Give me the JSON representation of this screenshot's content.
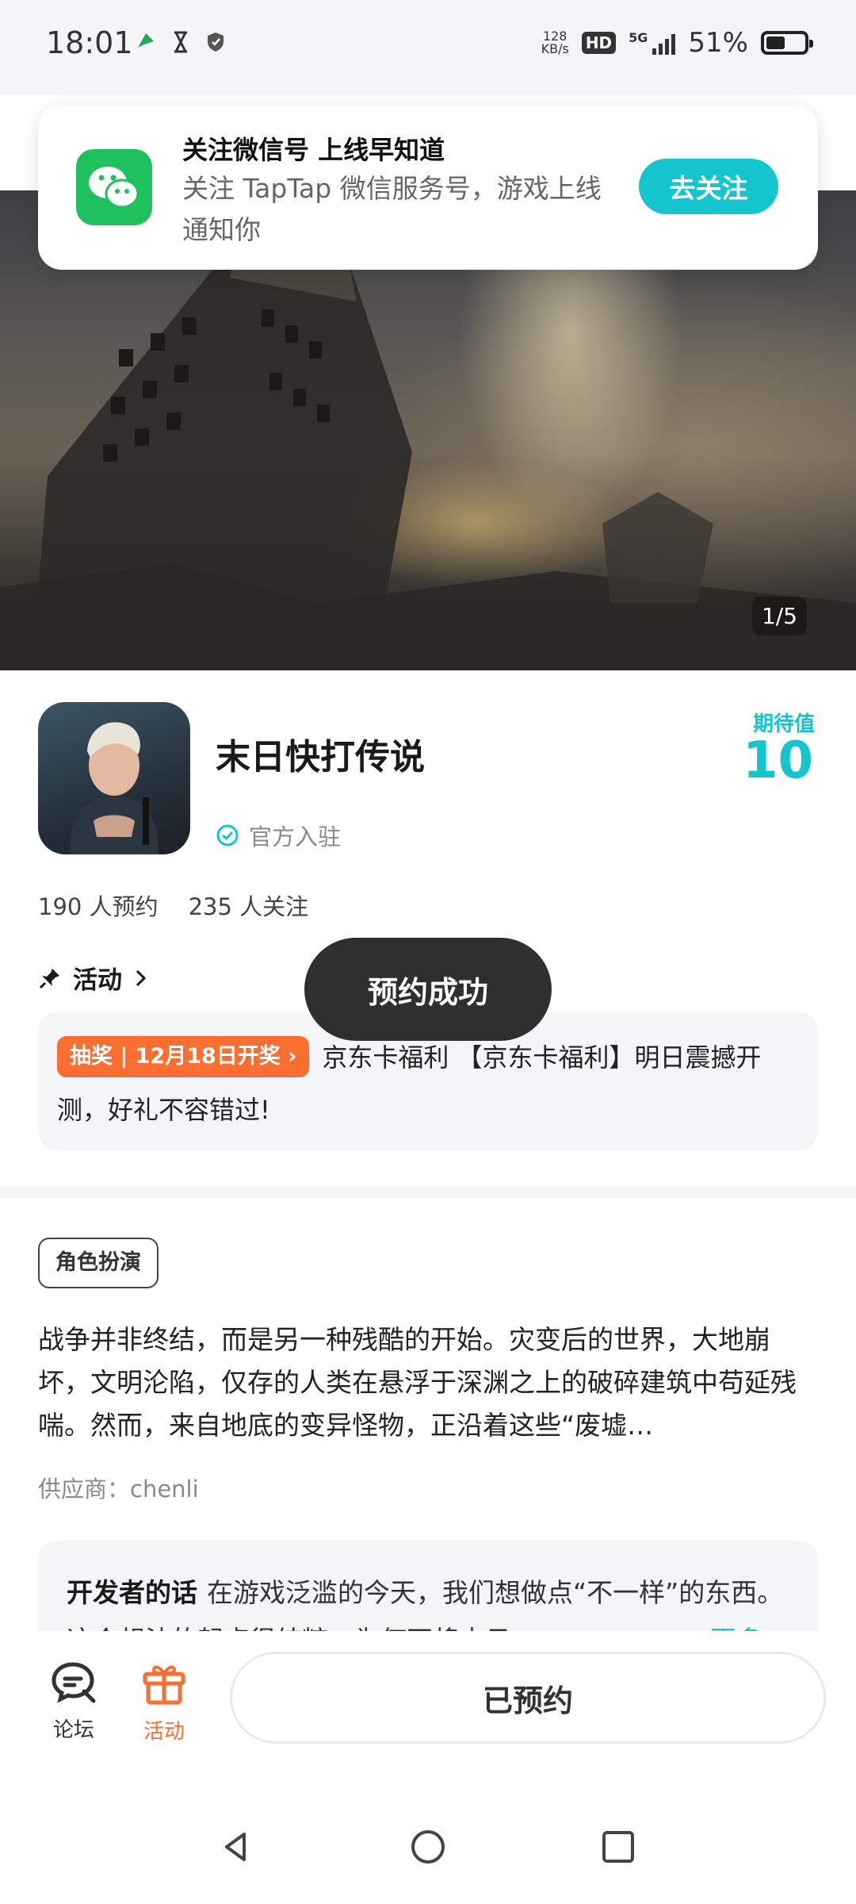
{
  "status_bar": {
    "time": "18:01",
    "net_speed_value": "128",
    "net_speed_unit": "KB/s",
    "hd": "HD",
    "network": "5G",
    "battery_percent_text": "51%",
    "battery_level": 0.51
  },
  "follow_banner": {
    "title": "关注微信号 上线早知道",
    "description": "关注 TapTap 微信服务号，游戏上线通知你",
    "button": "去关注",
    "icon": "wechat-icon"
  },
  "hero": {
    "counter": "1/5"
  },
  "game": {
    "title": "末日快打传说",
    "official_label": "官方入驻",
    "expectation_label": "期待值",
    "expectation_value": "10",
    "reservations": "190 人预约",
    "followers": "235 人关注"
  },
  "activity": {
    "heading": "活动",
    "tag": "抽奖 | 12月18日开奖",
    "text": "京东卡福利 【京东卡福利】明日震撼开测，好礼不容错过!"
  },
  "toast": "预约成功",
  "genre_tag": "角色扮演",
  "description": "战争并非终结，而是另一种残酷的开始。灾变后的世界，大地崩坏，文明沦陷，仅存的人类在悬浮于深渊之上的破碎建筑中苟延残喘。然而，来自地底的变异怪物，正沿着这些“废墟…",
  "supplier": "供应商：chenli",
  "developer": {
    "title": "开发者的话",
    "text": "在游戏泛滥的今天，我们想做点“不一样”的东西。这个想法的起点很纯粹：为何不将末日",
    "more": "更多"
  },
  "bottom_bar": {
    "forum_label": "论坛",
    "activity_label": "活动",
    "reserved_button": "已预约"
  },
  "colors": {
    "accent": "#15c5ce",
    "orange": "#fb6e31",
    "wechat_green": "#1fc15c"
  }
}
